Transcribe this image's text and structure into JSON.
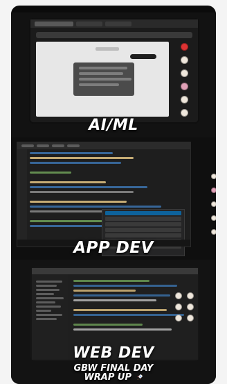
{
  "sections": [
    {
      "overlay_title": "AI/ML"
    },
    {
      "overlay_title": "APP DEV"
    },
    {
      "overlay_title": "WEB DEV"
    }
  ],
  "footer": {
    "line1": "GBW FINAL DAY",
    "line2": "WRAP UP"
  },
  "colors": {
    "card_bg": "#0b0b0b",
    "page_bg": "#f4f4f4",
    "overlay_text": "#ffffff",
    "accent_red": "#dd3333"
  },
  "icons": {
    "rocket": "rocket-icon"
  }
}
